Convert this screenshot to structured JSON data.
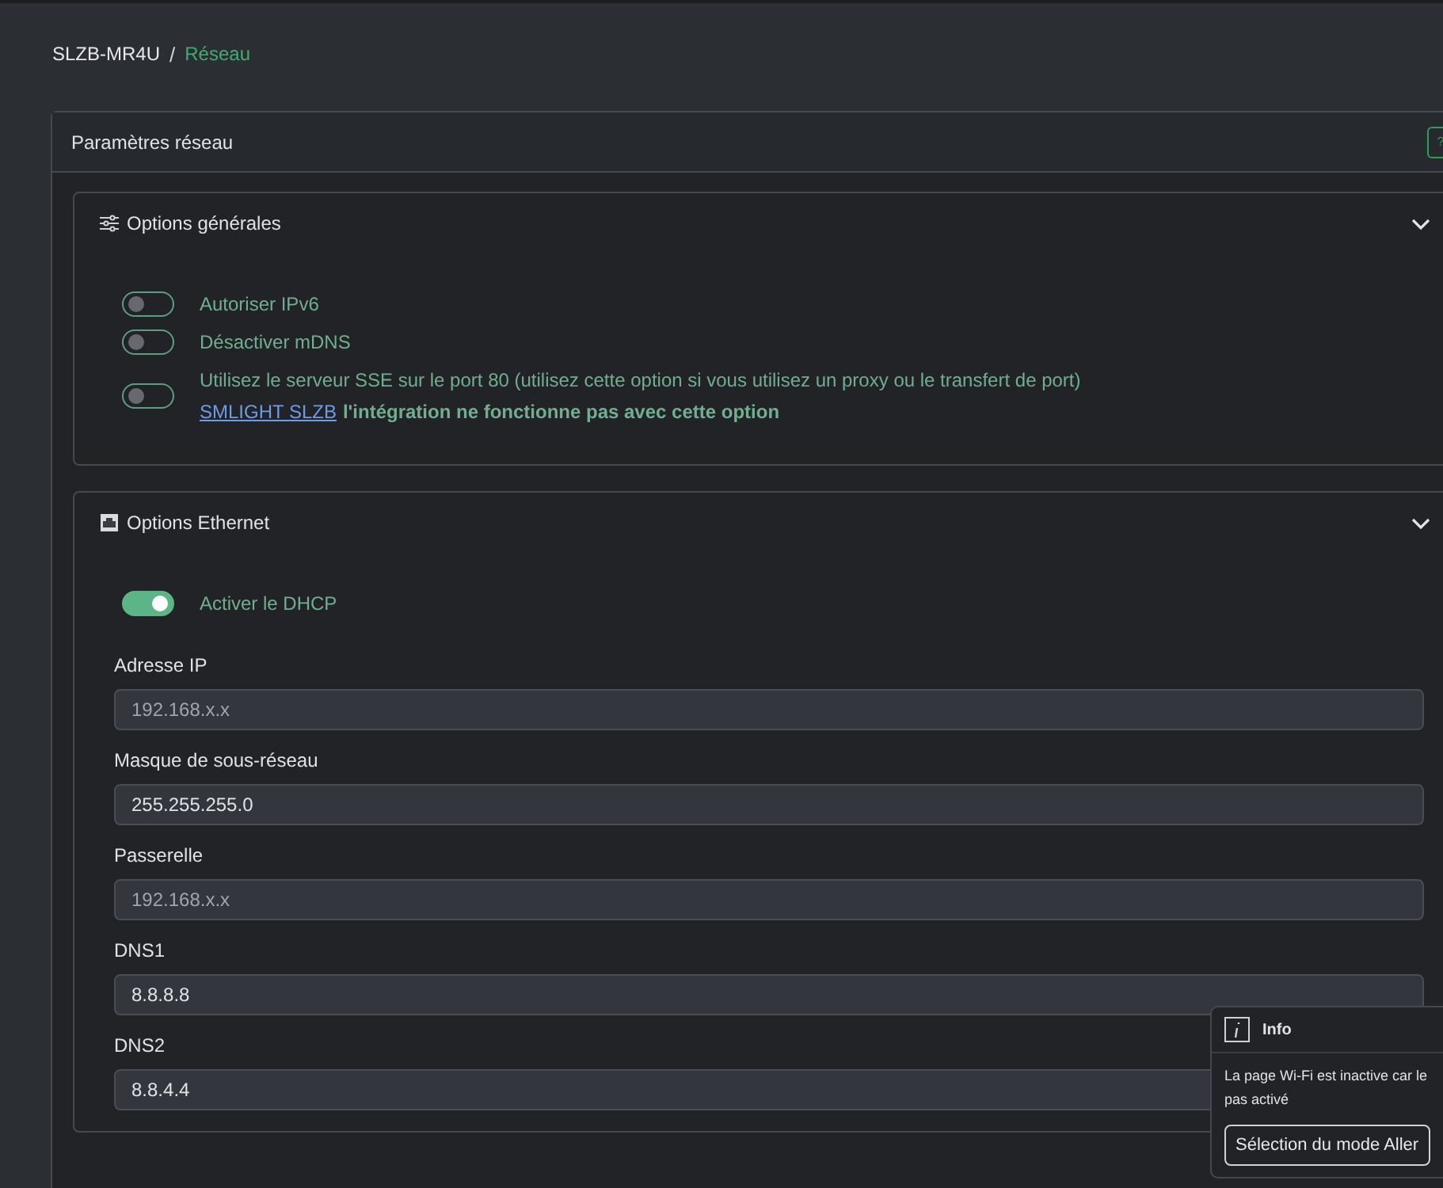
{
  "breadcrumb_separator": "/",
  "breadcrumb": [
    {
      "label": "SLZB-MR4U",
      "selected": false
    },
    {
      "label": "Réseau",
      "selected": true
    }
  ],
  "panel": {
    "title": "Paramètres réseau",
    "help_button": "?"
  },
  "sections": [
    {
      "title": "Options générales",
      "expanded": true,
      "switches": [
        {
          "label": "Autoriser IPv6",
          "on": false
        },
        {
          "label": "Désactiver mDNS",
          "on": false
        },
        {
          "label": "Utilisez le serveur SSE sur le port 80 (utilisez cette option si vous utilisez un proxy ou le transfert de port)",
          "link": "SMLIGHT SLZB",
          "note": "l'intégration ne fonctionne pas avec cette option",
          "on": false
        }
      ]
    },
    {
      "title": "Options Ethernet",
      "expanded": true,
      "switches": [
        {
          "label": "Activer le DHCP",
          "on": true
        }
      ],
      "fields": [
        {
          "label": "Adresse IP",
          "placeholder": "192.168.x.x"
        },
        {
          "label": "Masque de sous-réseau",
          "value": "255.255.255.0"
        },
        {
          "label": "Passerelle",
          "placeholder": "192.168.x.x"
        },
        {
          "label": "DNS1",
          "value": "8.8.8.8"
        },
        {
          "label": "DNS2",
          "value": "8.8.4.4"
        }
      ]
    }
  ],
  "toast": {
    "title": "Info",
    "message": "La page Wi-Fi est inactive car le",
    "message_2": "pas activé",
    "button": "Sélection du mode Aller"
  }
}
